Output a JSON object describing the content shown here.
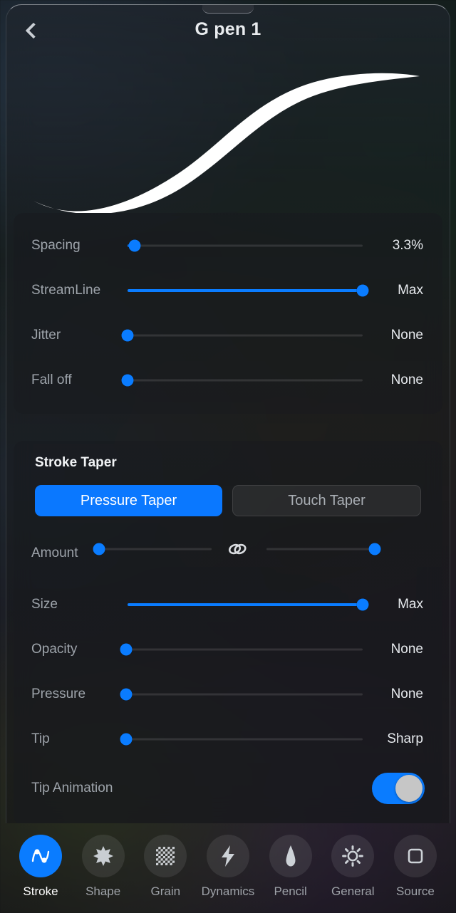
{
  "header": {
    "title": "G pen 1",
    "back_icon": "chevron-left-icon"
  },
  "preview": {
    "stroke_description": "tapered-s-curve-brush-stroke",
    "stroke_color": "#ffffff"
  },
  "colors": {
    "accent": "#0a7cff",
    "segment_active": "#0a78ff",
    "label": "#9ea4ab",
    "value": "#e7eaee"
  },
  "stroke_settings": [
    {
      "label": "Spacing",
      "value": "3.3%",
      "pct": 3
    },
    {
      "label": "StreamLine",
      "value": "Max",
      "pct": 100
    },
    {
      "label": "Jitter",
      "value": "None",
      "pct": 0
    },
    {
      "label": "Fall off",
      "value": "None",
      "pct": 0
    }
  ],
  "stroke_taper": {
    "heading": "Stroke Taper",
    "tabs": [
      {
        "label": "Pressure Taper",
        "active": true
      },
      {
        "label": "Touch Taper",
        "active": false
      }
    ],
    "amount": {
      "label": "Amount",
      "link_icon": "link-chain-icon",
      "left_pct": 0,
      "right_pct": 100
    },
    "sliders": [
      {
        "label": "Size",
        "value": "Max",
        "pct": 100
      },
      {
        "label": "Opacity",
        "value": "None",
        "pct": 0
      },
      {
        "label": "Pressure",
        "value": "None",
        "pct": 0
      },
      {
        "label": "Tip",
        "value": "Sharp",
        "pct": 0
      }
    ],
    "tip_animation": {
      "label": "Tip Animation",
      "enabled": true
    }
  },
  "tabbar": [
    {
      "label": "Stroke",
      "icon": "stroke-wave-icon",
      "active": true
    },
    {
      "label": "Shape",
      "icon": "burst-star-icon",
      "active": false
    },
    {
      "label": "Grain",
      "icon": "checkerboard-icon",
      "active": false
    },
    {
      "label": "Dynamics",
      "icon": "lightning-bolt-icon",
      "active": false
    },
    {
      "label": "Pencil",
      "icon": "pencil-tip-icon",
      "active": false
    },
    {
      "label": "General",
      "icon": "gear-icon",
      "active": false
    },
    {
      "label": "Source",
      "icon": "square-outline-icon",
      "active": false
    }
  ]
}
